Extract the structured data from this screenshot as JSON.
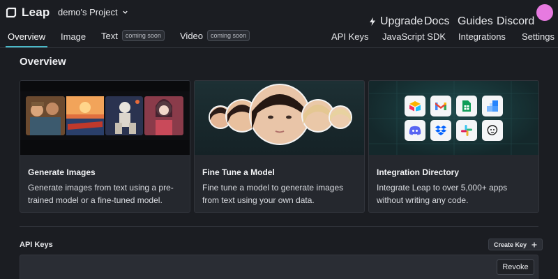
{
  "app": {
    "name": "Leap",
    "project": "demo's Project"
  },
  "topnav": {
    "upgrade": "Upgrade",
    "docs": "Docs",
    "guides": "Guides",
    "discord": "Discord"
  },
  "tabs": {
    "overview": "Overview",
    "image": "Image",
    "text": "Text",
    "text_badge": "coming soon",
    "video": "Video",
    "video_badge": "coming soon",
    "api_keys": "API Keys",
    "js_sdk": "JavaScript SDK",
    "integrations": "Integrations",
    "settings": "Settings"
  },
  "overview": {
    "title": "Overview",
    "cards": [
      {
        "title": "Generate Images",
        "description": "Generate images from text using a pre-trained model or a fine-tuned model."
      },
      {
        "title": "Fine Tune a Model",
        "description": "Fine tune a model to generate images from text using your own data."
      },
      {
        "title": "Integration Directory",
        "description": "Integrate Leap to over 5,000+ apps without writing any code."
      }
    ]
  },
  "api_keys": {
    "title": "API Keys",
    "create_label": "Create Key",
    "revoke_label": "Revoke"
  },
  "icons": {
    "integrations": [
      "airtable-icon",
      "gmail-icon",
      "google-sheets-icon",
      "squares-icon",
      "discord-icon",
      "dropbox-icon",
      "slack-icon",
      "mailchimp-icon"
    ]
  },
  "colors": {
    "accent": "#4ab9c8",
    "avatar": "#e77ae0",
    "background": "#1b1d22"
  }
}
